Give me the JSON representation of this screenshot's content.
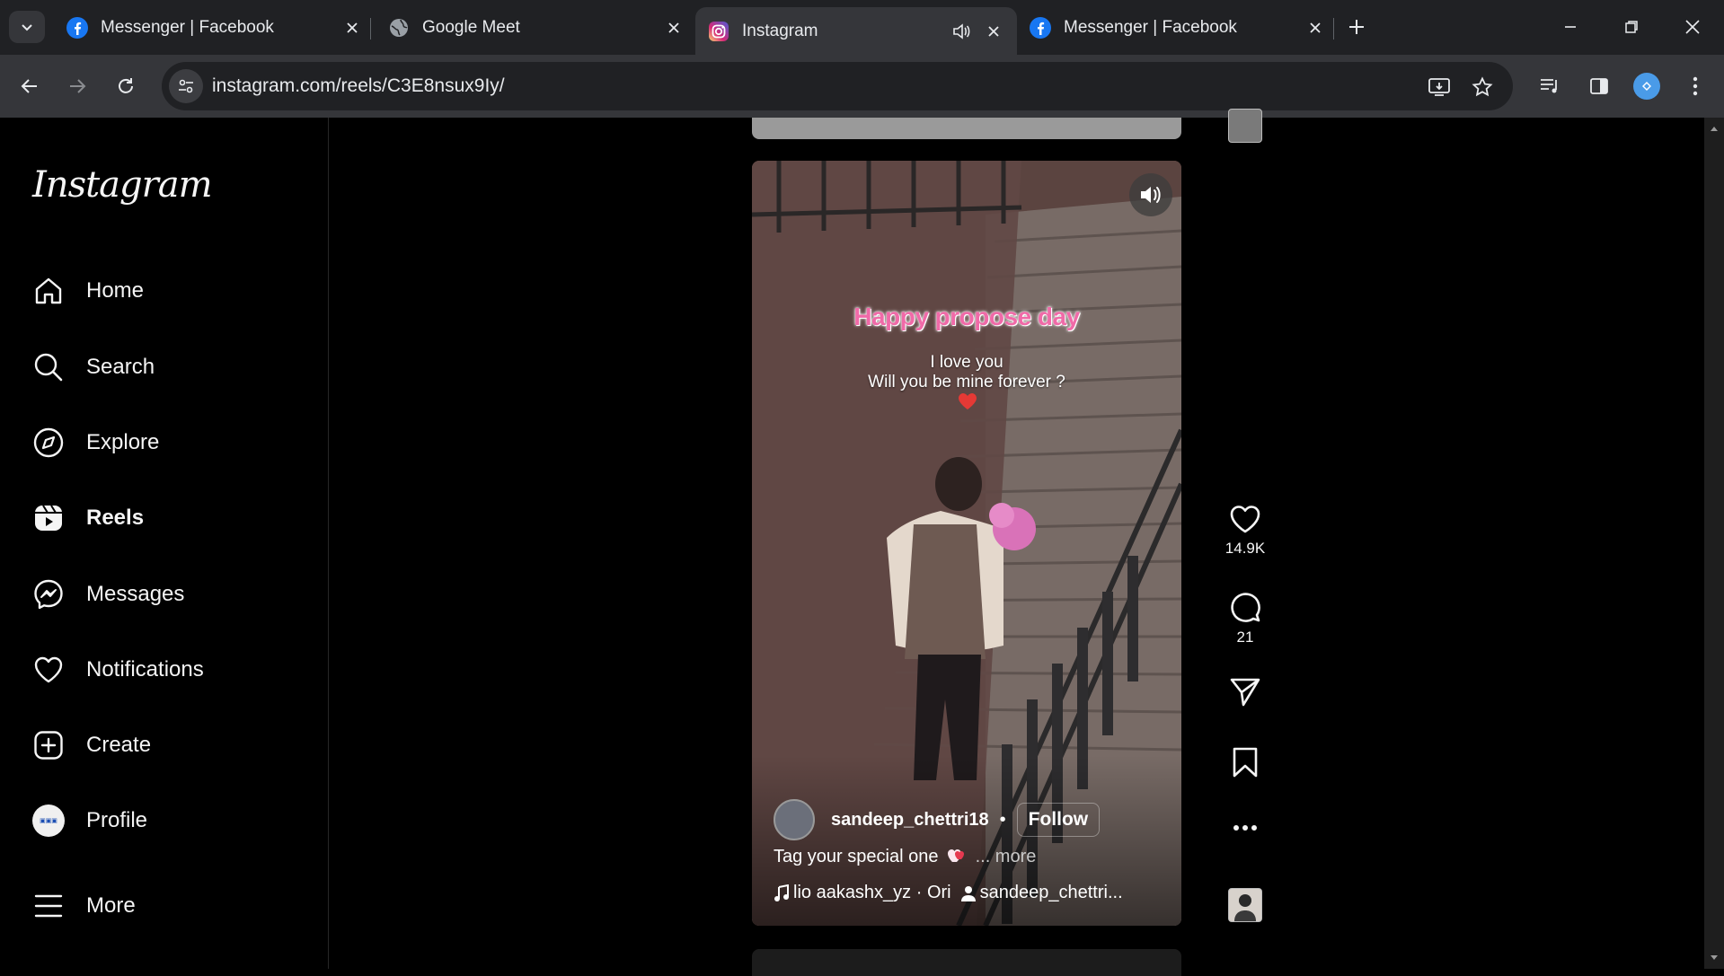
{
  "browser": {
    "tabs": [
      {
        "title": "Messenger | Facebook",
        "icon": "facebook-icon",
        "active": false
      },
      {
        "title": "Google Meet",
        "icon": "globe-icon",
        "active": false
      },
      {
        "title": "Instagram",
        "icon": "instagram-icon",
        "active": true,
        "audio": true
      },
      {
        "title": "Messenger | Facebook",
        "icon": "facebook-icon",
        "active": false
      }
    ],
    "url": "instagram.com/reels/C3E8nsux9Iy/"
  },
  "sidebar": {
    "logo": "Instagram",
    "items": [
      {
        "label": "Home",
        "icon": "home-icon"
      },
      {
        "label": "Search",
        "icon": "search-icon"
      },
      {
        "label": "Explore",
        "icon": "compass-icon"
      },
      {
        "label": "Reels",
        "icon": "reels-icon",
        "active": true
      },
      {
        "label": "Messages",
        "icon": "messenger-icon"
      },
      {
        "label": "Notifications",
        "icon": "heart-icon"
      },
      {
        "label": "Create",
        "icon": "plus-square-icon"
      },
      {
        "label": "Profile",
        "icon": "profile-avatar"
      },
      {
        "label": "More",
        "icon": "menu-icon"
      }
    ]
  },
  "reel": {
    "overlay_title": "Happy propose day",
    "overlay_line1": "I love you",
    "overlay_line2": "Will you be mine forever ?",
    "author": "sandeep_chettri18",
    "follow": "Follow",
    "caption": "Tag your special one",
    "caption_more": "... more",
    "audio_text": "lio  aakashx_yz · Ori",
    "tagged_user": "sandeep_chettri..."
  },
  "actions": {
    "likes": "14.9K",
    "comments": "21"
  },
  "colors": {
    "chrome_dark": "#202124",
    "chrome_toolbar": "#35363a",
    "overlay_pink": "#f06aa8",
    "heart_red": "#e53935"
  }
}
